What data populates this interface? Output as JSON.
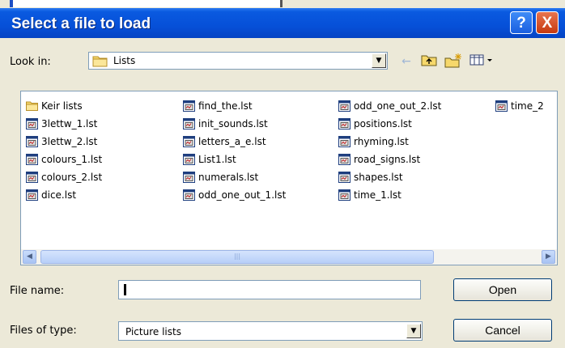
{
  "dialog": {
    "title": "Select a file to load",
    "help_label": "?",
    "close_label": "X"
  },
  "lookin": {
    "label": "Look in:",
    "value": "Lists",
    "tools": [
      "back-icon",
      "up-folder-icon",
      "new-folder-icon",
      "view-menu-icon"
    ]
  },
  "files": {
    "columns": [
      [
        {
          "name": "Keir lists",
          "icon": "folder-icon"
        },
        {
          "name": "3lettw_1.lst",
          "icon": "list-file-icon"
        },
        {
          "name": "3lettw_2.lst",
          "icon": "list-file-icon"
        },
        {
          "name": "colours_1.lst",
          "icon": "list-file-icon"
        },
        {
          "name": "colours_2.lst",
          "icon": "list-file-icon"
        },
        {
          "name": "dice.lst",
          "icon": "list-file-icon"
        }
      ],
      [
        {
          "name": "find_the.lst",
          "icon": "list-file-icon"
        },
        {
          "name": "init_sounds.lst",
          "icon": "list-file-icon"
        },
        {
          "name": "letters_a_e.lst",
          "icon": "list-file-icon"
        },
        {
          "name": "List1.lst",
          "icon": "list-file-icon"
        },
        {
          "name": "numerals.lst",
          "icon": "list-file-icon"
        },
        {
          "name": "odd_one_out_1.lst",
          "icon": "list-file-icon"
        }
      ],
      [
        {
          "name": "odd_one_out_2.lst",
          "icon": "list-file-icon"
        },
        {
          "name": "positions.lst",
          "icon": "list-file-icon"
        },
        {
          "name": "rhyming.lst",
          "icon": "list-file-icon"
        },
        {
          "name": "road_signs.lst",
          "icon": "list-file-icon"
        },
        {
          "name": "shapes.lst",
          "icon": "list-file-icon"
        },
        {
          "name": "time_1.lst",
          "icon": "list-file-icon"
        }
      ],
      [
        {
          "name": "time_2",
          "icon": "list-file-icon"
        }
      ]
    ]
  },
  "filename": {
    "label": "File name:",
    "value": ""
  },
  "filetype": {
    "label": "Files of type:",
    "value": "Picture lists"
  },
  "buttons": {
    "open": "Open",
    "cancel": "Cancel"
  },
  "colors": {
    "title_bar": "#0650d8",
    "dialog_bg": "#ece9d8",
    "field_border": "#7f9db9"
  }
}
